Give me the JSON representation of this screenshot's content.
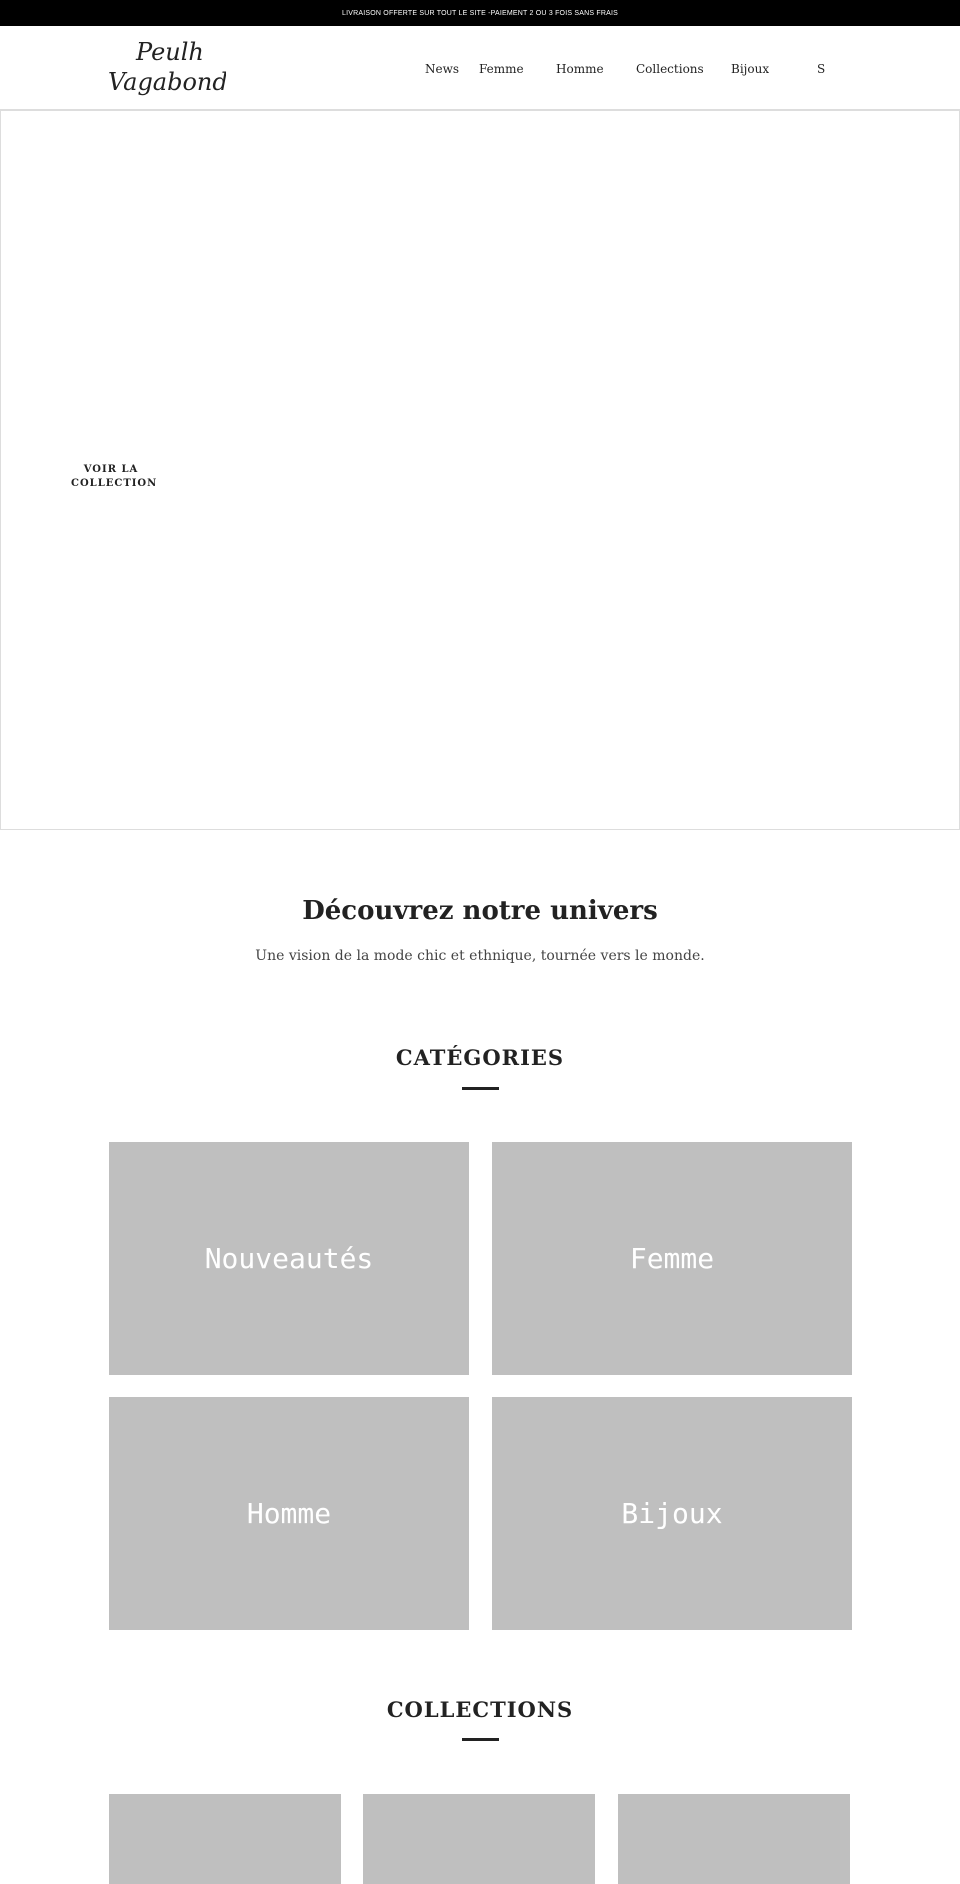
{
  "announcement": "LIVRAISON OFFERTE SUR TOUT LE SITE -PAIEMENT 2 OU 3 FOIS SANS FRAIS",
  "logo": {
    "line1": "Peulh",
    "line2": "Vagabond"
  },
  "nav": [
    "News",
    "Femme",
    "Homme",
    "Collections",
    "Bijoux",
    "S"
  ],
  "hero": {
    "cta": "VOIR LA COLLECTION"
  },
  "intro": {
    "title": "Découvrez notre univers",
    "subtitle": "Une vision de la mode chic et ethnique, tournée vers le monde."
  },
  "categories": {
    "title": "CATÉGORIES",
    "items": [
      "Nouveautés",
      "Femme",
      "Homme",
      "Bijoux"
    ]
  },
  "collections": {
    "title": "COLLECTIONS"
  }
}
